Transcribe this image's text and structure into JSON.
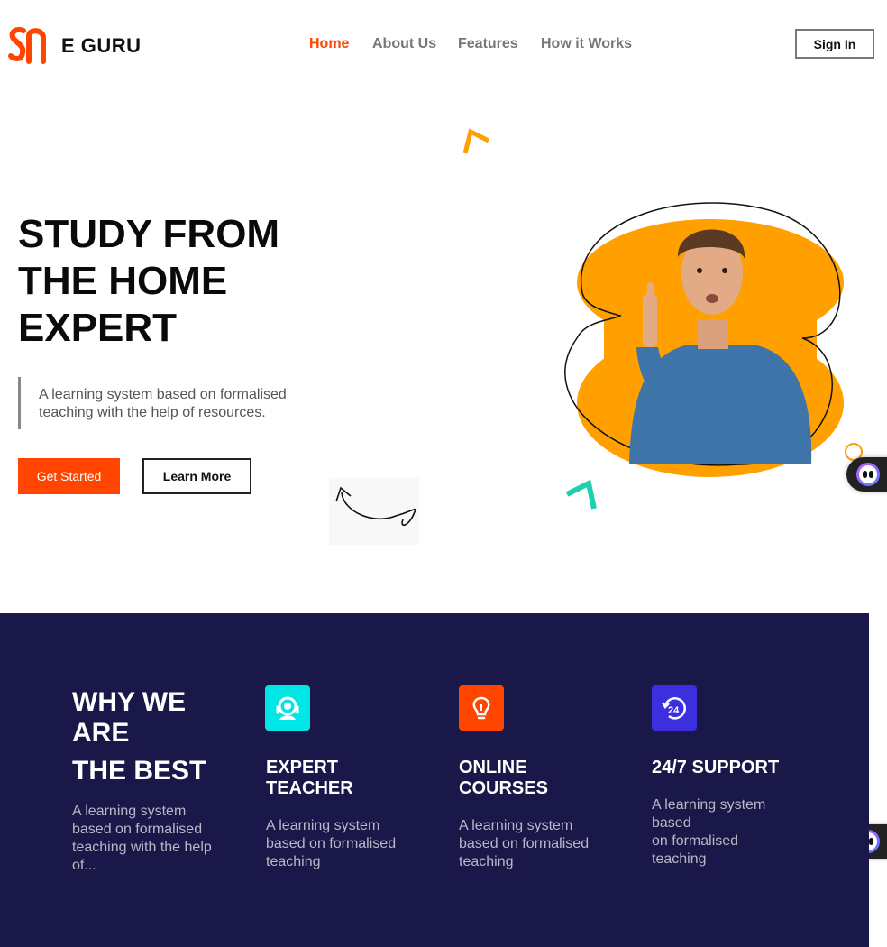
{
  "header": {
    "brand": "E GURU",
    "nav": [
      {
        "label": "Home",
        "active": true
      },
      {
        "label": "About Us",
        "active": false
      },
      {
        "label": "Features",
        "active": false
      },
      {
        "label": "How it Works",
        "active": false
      }
    ],
    "signin_label": "Sign In"
  },
  "hero": {
    "title_lines": [
      "STUDY FROM",
      "THE HOME",
      "EXPERT"
    ],
    "description": "A learning system based on formalised teaching with the help of resources.",
    "primary_cta": "Get Started",
    "secondary_cta": "Learn More"
  },
  "features": {
    "heading_lines": [
      "WHY WE",
      "ARE",
      "THE BEST"
    ],
    "description": "A learning system based on formalised teaching with the help of...",
    "items": [
      {
        "icon": "teacher-headset-icon",
        "color": "#00e5e5",
        "title_lines": [
          "EXPERT",
          "TEACHER"
        ],
        "description": "A learning system based on formalised teaching"
      },
      {
        "icon": "lightbulb-icon",
        "color": "#ff4500",
        "title_lines": [
          "ONLINE",
          "COURSES"
        ],
        "description": "A learning system based on formalised teaching"
      },
      {
        "icon": "support-24-icon",
        "color": "#3b2fe0",
        "title_lines": [
          "24/7 SUPPORT"
        ],
        "description_lines": [
          "A learning system",
          "based",
          "on formalised",
          "teaching"
        ]
      }
    ]
  },
  "colors": {
    "accent": "#ff4500",
    "hero_blob": "#ffa000",
    "features_bg": "#1a1848",
    "deco_teal": "#1ecfb0"
  }
}
